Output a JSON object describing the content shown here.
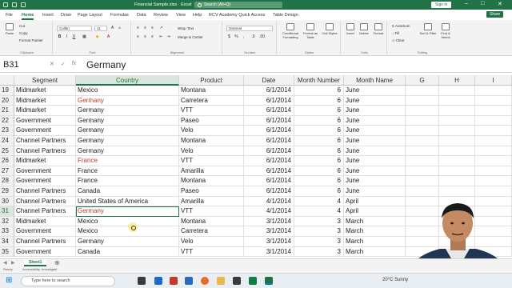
{
  "titlebar": {
    "title": "Financial Sample.xlsx  ·  Excel",
    "search_placeholder": "Search (Alt+Q)",
    "signin_label": "Sign in"
  },
  "tabs": [
    "File",
    "Home",
    "Insert",
    "Draw",
    "Page Layout",
    "Formulas",
    "Data",
    "Review",
    "View",
    "Help",
    "RCV Academy Quick Access",
    "Table Design"
  ],
  "share_label": "Share",
  "ribbon": {
    "clipboard": {
      "paste": "Paste",
      "cut": "Cut",
      "copy": "Copy",
      "format_painter": "Format Painter",
      "label": "Clipboard"
    },
    "font": {
      "name": "Calibri",
      "size": "11",
      "label": "Font"
    },
    "alignment": {
      "wrap": "Wrap Text",
      "merge": "Merge & Center",
      "label": "Alignment"
    },
    "number": {
      "format": "General",
      "label": "Number"
    },
    "styles": {
      "conditional": "Conditional Formatting",
      "format_table": "Format as Table",
      "cell_styles": "Cell Styles",
      "label": "Styles"
    },
    "cells": {
      "insert": "Insert",
      "delete": "Delete",
      "format": "Format",
      "label": "Cells"
    },
    "editing": {
      "autosum": "AutoSum",
      "fill": "Fill",
      "clear": "Clear",
      "sort": "Sort & Filter",
      "find": "Find & Select",
      "label": "Editing"
    }
  },
  "formula_bar": {
    "name_box": "B31",
    "content": "Germany"
  },
  "columns": [
    "Segment",
    "Country",
    "Product",
    "Date",
    "Month Number",
    "Month Name",
    "G",
    "H",
    "I"
  ],
  "rows": [
    {
      "n": "19",
      "segment": "Midmarket",
      "country": "Mexico",
      "product": "Montana",
      "date": "6/1/2014",
      "month_number": "6",
      "month_name": "June"
    },
    {
      "n": "20",
      "segment": "Midmarket",
      "country": "Germany",
      "product": "Carretera",
      "date": "6/1/2014",
      "month_number": "6",
      "month_name": "June"
    },
    {
      "n": "21",
      "segment": "Midmarket",
      "country": "Germany",
      "product": "VTT",
      "date": "6/1/2014",
      "month_number": "6",
      "month_name": "June"
    },
    {
      "n": "22",
      "segment": "Government",
      "country": "Germany",
      "product": "Paseo",
      "date": "6/1/2014",
      "month_number": "6",
      "month_name": "June"
    },
    {
      "n": "23",
      "segment": "Government",
      "country": "Germany",
      "product": "Velo",
      "date": "6/1/2014",
      "month_number": "6",
      "month_name": "June"
    },
    {
      "n": "24",
      "segment": "Channel Partners",
      "country": "Germany",
      "product": "Montana",
      "date": "6/1/2014",
      "month_number": "6",
      "month_name": "June"
    },
    {
      "n": "25",
      "segment": "Channel Partners",
      "country": "Germany",
      "product": "Velo",
      "date": "6/1/2014",
      "month_number": "6",
      "month_name": "June"
    },
    {
      "n": "26",
      "segment": "Midmarket",
      "country": "France",
      "product": "VTT",
      "date": "6/1/2014",
      "month_number": "6",
      "month_name": "June"
    },
    {
      "n": "27",
      "segment": "Government",
      "country": "France",
      "product": "Amarilla",
      "date": "6/1/2014",
      "month_number": "6",
      "month_name": "June"
    },
    {
      "n": "28",
      "segment": "Government",
      "country": "France",
      "product": "Montana",
      "date": "6/1/2014",
      "month_number": "6",
      "month_name": "June"
    },
    {
      "n": "29",
      "segment": "Channel Partners",
      "country": "Canada",
      "product": "Paseo",
      "date": "6/1/2014",
      "month_number": "6",
      "month_name": "June"
    },
    {
      "n": "30",
      "segment": "Channel Partners",
      "country": "United States of America",
      "product": "Amarilla",
      "date": "4/1/2014",
      "month_number": "4",
      "month_name": "April"
    },
    {
      "n": "31",
      "segment": "Channel Partners",
      "country": "Germany",
      "product": "VTT",
      "date": "4/1/2014",
      "month_number": "4",
      "month_name": "April"
    },
    {
      "n": "32",
      "segment": "Midmarket",
      "country": "Mexico",
      "product": "Montana",
      "date": "3/1/2014",
      "month_number": "3",
      "month_name": "March"
    },
    {
      "n": "33",
      "segment": "Government",
      "country": "Mexico",
      "product": "Carretera",
      "date": "3/1/2014",
      "month_number": "3",
      "month_name": "March"
    },
    {
      "n": "34",
      "segment": "Channel Partners",
      "country": "Germany",
      "product": "Velo",
      "date": "3/1/2014",
      "month_number": "3",
      "month_name": "March"
    },
    {
      "n": "35",
      "segment": "Government",
      "country": "Canada",
      "product": "VTT",
      "date": "3/1/2014",
      "month_number": "3",
      "month_name": "March"
    }
  ],
  "red_rows": [
    "20",
    "26",
    "31"
  ],
  "selected_row": "31",
  "sheet_tab": "Sheet1",
  "status": {
    "ready": "Ready",
    "accessibility": "Accessibility: Investigate"
  },
  "taskbar": {
    "search_placeholder": "Type here to search",
    "weather": "20°C  Sunny"
  },
  "colors": {
    "accent": "#217346",
    "red_text": "#c0392b"
  }
}
